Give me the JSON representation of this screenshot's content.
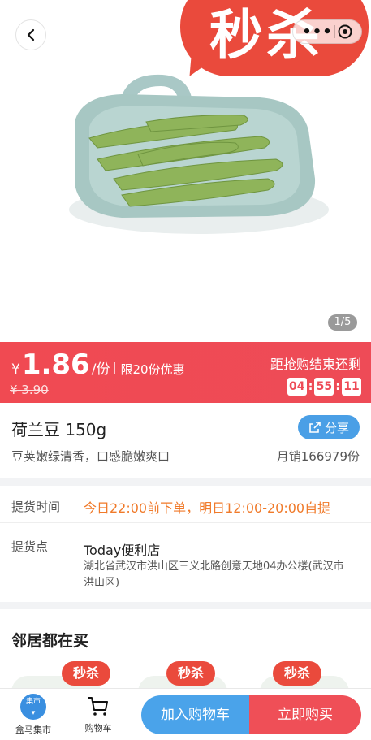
{
  "hero": {
    "flash_sale_badge": "秒杀",
    "image_counter": "1/5"
  },
  "price": {
    "currency": "¥",
    "amount": "1.86",
    "unit": "/份",
    "limit_text": "限20份优惠",
    "original": "¥ 3.90",
    "countdown_label": "距抢购结束还剩",
    "countdown": [
      "04",
      "55",
      "11"
    ]
  },
  "product": {
    "title": "荷兰豆 150g",
    "description": "豆荚嫩绿清香，口感脆嫩爽口",
    "monthly_sales": "月销166979份",
    "share_label": "分享"
  },
  "pickup": {
    "time_label": "提货时间",
    "time_value": "今日22:00前下单，明日12:00-20:00自提",
    "point_label": "提货点",
    "store_name": "Today便利店",
    "address": "湖北省武汉市洪山区三义北路创意天地04办公楼(武汉市洪山区)"
  },
  "neighbors": {
    "heading": "邻居都在买",
    "tags": [
      "秒杀",
      "秒杀",
      "秒杀"
    ]
  },
  "bottom_bar": {
    "home_logo_text": "集市",
    "home_label": "盒马集市",
    "cart_label": "购物车",
    "add_to_cart": "加入购物车",
    "buy_now": "立即购买"
  },
  "colors": {
    "price_red": "#ee4b57",
    "pickup_orange": "#f07a2a",
    "share_blue": "#4a9fe6"
  }
}
